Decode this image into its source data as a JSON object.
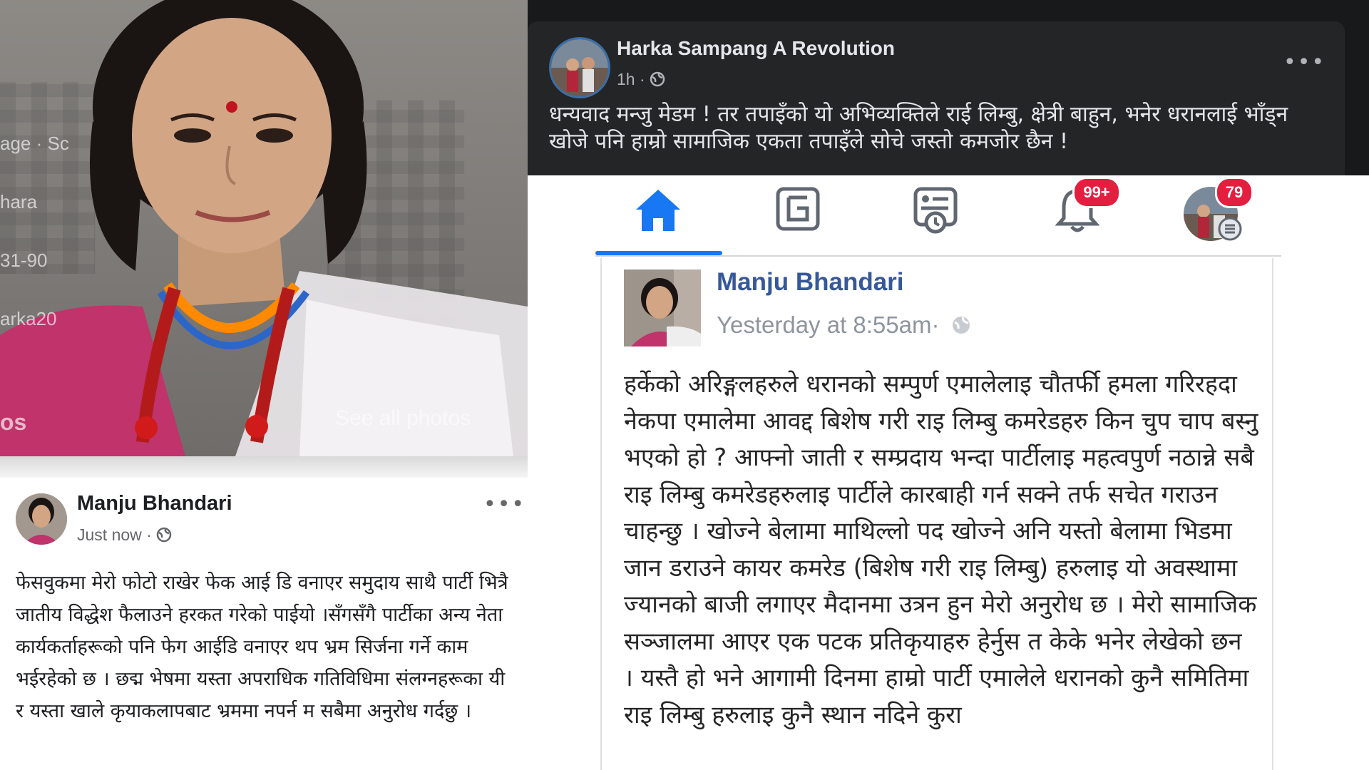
{
  "left_photo": {
    "overlay_labels": [
      "age · Sc",
      "hara",
      "31-90",
      "arka20",
      "os"
    ],
    "see_all_photos": "See all photos"
  },
  "left_post": {
    "author": "Manju Bhandari",
    "time": "Just now ·",
    "more": "•••",
    "body": "फेसवुकमा मेरो फोटो राखेर फेक आई डि वनाएर  समुदाय साथै पार्टी भित्रै जातीय विद्धेश फैलाउने हरकत गरेको पाईयो ।सँगसँगै पार्टीका अन्य नेता कार्यकर्ताहरूको पनि फेग आईडि वनाएर थप भ्रम सिर्जना गर्ने काम भईरहेको छ ।  छद्म भेषमा यस्ता अपराधिक गतिविधिमा संलग्नहरूका यी र यस्ता खाले कृयाकलापबाट भ्रममा नपर्न म सबैमा अनुरोध गर्दछु ।"
  },
  "right_post": {
    "author": "Harka Sampang A Revolution",
    "time": "1h ·",
    "more": "•••",
    "body": "धन्यवाद मन्जु मेडम ! तर तपाइँको यो अभिव्यक्तिले राई लिम्बु, क्षेत्री बाहुन, भनेर धरानलाई भाँड्न खोजे पनि हाम्रो सामाजिक एकता तपाइँले सोचे जस्तो कमजोर छैन !"
  },
  "nav": {
    "notifications_badge": "99+",
    "menu_badge": "79"
  },
  "screenshot_post": {
    "author": "Manju Bhandari",
    "time": "Yesterday at 8:55am·",
    "body": "हर्केको अरिङ्गलहरुले धरानको सम्पुर्ण एमालेलाइ चौतर्फी हमला गरिरहदा नेकपा एमालेमा आवद्द बिशेष गरी राइ लिम्बु कमरेडहरु किन चुप चाप बस्नु भएको हो ? आफ्नो जाती र सम्प्रदाय भन्दा पार्टीलाइ महत्वपुर्ण नठान्ने सबै राइ लिम्बु कमरेडहरुलाइ पार्टीले कारबाही गर्न सक्ने तर्फ सचेत गराउन चाहन्छु । खोज्ने बेलामा माथिल्लो पद खोज्ने अनि यस्तो बेलामा भिडमा जान डराउने कायर कमरेड (बिशेष गरी राइ लिम्बु) हरुलाइ यो अवस्थामा ज्यानको बाजी लगाएर मैदानमा उत्रन हुन मेरो अनुरोध छ । मेरो सामाजिक सञ्जालमा आएर एक पटक प्रतिकृयाहरु हेर्नुस त केके भनेर लेखेको छन । यस्तै हो भने आगामी दिनमा हाम्रो पार्टी एमालेले धरानको कुनै समितिमा राइ लिम्बु हरुलाइ कुनै स्थान नदिने कुरा"
  },
  "colors": {
    "fb_blue": "#1877f2",
    "dark_card": "#242526",
    "badge_red": "#e41e3f",
    "name_blue": "#365899"
  }
}
